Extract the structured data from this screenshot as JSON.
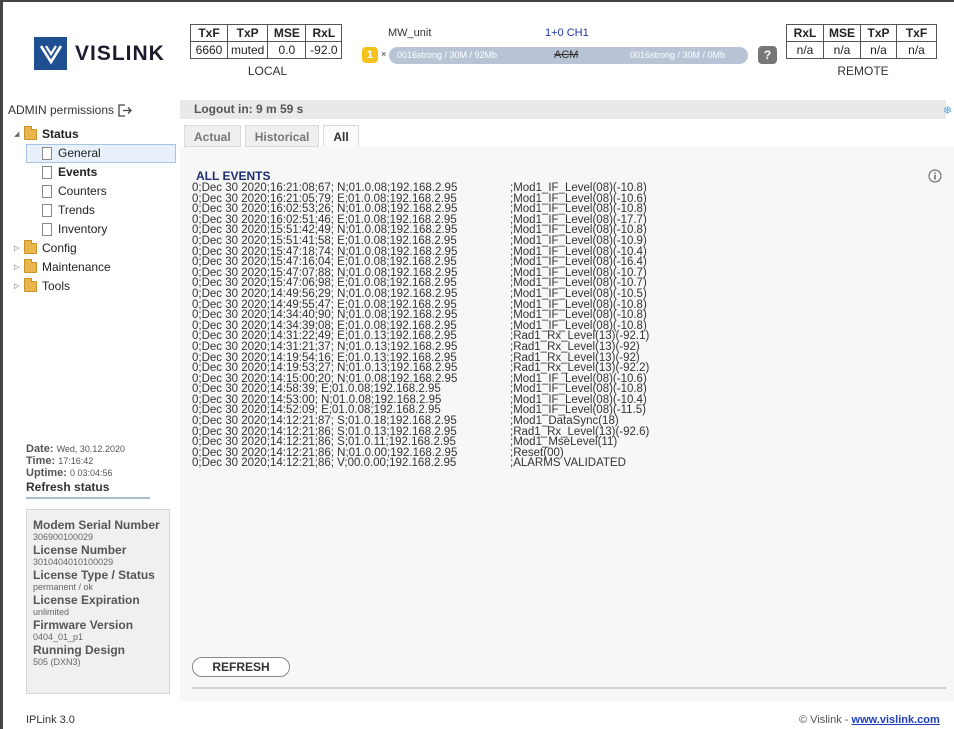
{
  "logo": {
    "text": "VISLINK"
  },
  "local": {
    "headers": [
      "TxF",
      "TxP",
      "MSE",
      "RxL"
    ],
    "values": [
      "6660",
      "muted",
      "0.0",
      "-92.0"
    ],
    "caption": "LOCAL"
  },
  "remote": {
    "headers": [
      "RxL",
      "MSE",
      "TxP",
      "TxF"
    ],
    "values": [
      "n/a",
      "n/a",
      "n/a",
      "n/a"
    ],
    "caption": "REMOTE"
  },
  "link": {
    "unit": "MW_unit",
    "channel": "1+0 CH1",
    "badge": "1",
    "multiplier": "×",
    "left_modulation": "0016strong / 30M / 92Mb",
    "mode": "ACM",
    "right_modulation": "0016strong / 30M / 0Mb",
    "help": "?"
  },
  "sidebar": {
    "admin": "ADMIN permissions",
    "status": "Status",
    "status_items": [
      "General",
      "Events",
      "Counters",
      "Trends",
      "Inventory"
    ],
    "config": "Config",
    "maintenance": "Maintenance",
    "tools": "Tools",
    "date_label": "Date:",
    "date_value": "Wed, 30.12.2020",
    "time_label": "Time:",
    "time_value": "17:16:42",
    "uptime_label": "Uptime:",
    "uptime_value": "0 03:04:56",
    "refresh_status": "Refresh status",
    "modem_serial_label": "Modem Serial Number",
    "modem_serial_value": "306900100029",
    "license_number_label": "License Number",
    "license_number_value": "3010404010100029",
    "license_type_label": "License Type / Status",
    "license_type_value": "permanent / ok",
    "license_exp_label": "License Expiration",
    "license_exp_value": "unlimited",
    "firmware_label": "Firmware Version",
    "firmware_value": "0404_01_p1",
    "design_label": "Running Design",
    "design_value": "505 (DXN3)"
  },
  "main": {
    "logout": "Logout in: 9 m 59 s",
    "tabs": [
      "Actual",
      "Historical",
      "All"
    ],
    "events_title": "ALL EVENTS",
    "refresh_button": "REFRESH",
    "events": [
      {
        "ts": "0;Dec 30 2020;16:21:08;67; N;01.0.08;192.168.2.95",
        "msg": ";Mod1_IF_Level(08)(-10.8)"
      },
      {
        "ts": "0;Dec 30 2020;16:21:05;79; E;01.0.08;192.168.2.95",
        "msg": ";Mod1_IF_Level(08)(-10.6)"
      },
      {
        "ts": "0;Dec 30 2020;16:02:53;26; N;01.0.08;192.168.2.95",
        "msg": ";Mod1_IF_Level(08)(-10.8)"
      },
      {
        "ts": "0;Dec 30 2020;16:02:51;46; E;01.0.08;192.168.2.95",
        "msg": ";Mod1_IF_Level(08)(-17.7)"
      },
      {
        "ts": "0;Dec 30 2020;15:51:42;49; N;01.0.08;192.168.2.95",
        "msg": ";Mod1_IF_Level(08)(-10.8)"
      },
      {
        "ts": "0;Dec 30 2020;15:51:41;58; E;01.0.08;192.168.2.95",
        "msg": ";Mod1_IF_Level(08)(-10.9)"
      },
      {
        "ts": "0;Dec 30 2020;15:47:18;74; N;01.0.08;192.168.2.95",
        "msg": ";Mod1_IF_Level(08)(-10.4)"
      },
      {
        "ts": "0;Dec 30 2020;15:47:16;04; E;01.0.08;192.168.2.95",
        "msg": ";Mod1_IF_Level(08)(-16.4)"
      },
      {
        "ts": "0;Dec 30 2020;15:47:07;88; N;01.0.08;192.168.2.95",
        "msg": ";Mod1_IF_Level(08)(-10.7)"
      },
      {
        "ts": "0;Dec 30 2020;15:47:06;98; E;01.0.08;192.168.2.95",
        "msg": ";Mod1_IF_Level(08)(-10.7)"
      },
      {
        "ts": "0;Dec 30 2020;14:49:56;29; N;01.0.08;192.168.2.95",
        "msg": ";Mod1_IF_Level(08)(-10.5)"
      },
      {
        "ts": "0;Dec 30 2020;14:49:55;47; E;01.0.08;192.168.2.95",
        "msg": ";Mod1_IF_Level(08)(-10.8)"
      },
      {
        "ts": "0;Dec 30 2020;14:34:40;90; N;01.0.08;192.168.2.95",
        "msg": ";Mod1_IF_Level(08)(-10.8)"
      },
      {
        "ts": "0;Dec 30 2020;14:34:39;08; E;01.0.08;192.168.2.95",
        "msg": ";Mod1_IF_Level(08)(-10.8)"
      },
      {
        "ts": "0;Dec 30 2020;14:31:22;49; E;01.0.13;192.168.2.95",
        "msg": ";Rad1_Rx_Level(13)(-92.1)"
      },
      {
        "ts": "0;Dec 30 2020;14:31:21;37; N;01.0.13;192.168.2.95",
        "msg": ";Rad1_Rx_Level(13)(-92)"
      },
      {
        "ts": "0;Dec 30 2020;14:19:54;16; E;01.0.13;192.168.2.95",
        "msg": ";Rad1_Rx_Level(13)(-92)"
      },
      {
        "ts": "0;Dec 30 2020;14:19:53;27; N;01.0.13;192.168.2.95",
        "msg": ";Rad1_Rx_Level(13)(-92.2)"
      },
      {
        "ts": "0;Dec 30 2020;14:15:00;20; N;01.0.08;192.168.2.95",
        "msg": ";Mod1_IF_Level(08)(-10.6)"
      },
      {
        "ts": "0;Dec 30 2020;14:58:39; E;01.0.08;192.168.2.95",
        "msg": ";Mod1_IF_Level(08)(-10.8)"
      },
      {
        "ts": "0;Dec 30 2020;14:53:00; N;01.0.08;192.168.2.95",
        "msg": ";Mod1_IF_Level(08)(-10.4)"
      },
      {
        "ts": "0;Dec 30 2020;14:52:09; E;01.0.08;192.168.2.95",
        "msg": ";Mod1_IF_Level(08)(-11.5)"
      },
      {
        "ts": "0;Dec 30 2020;14:12:21;87; S;01.0.18;192.168.2.95",
        "msg": ";Mod1_DataSync(18)"
      },
      {
        "ts": "0;Dec 30 2020;14:12:21;86; S;01.0.13;192.168.2.95",
        "msg": ";Rad1_Rx_Level(13)(-92.6)"
      },
      {
        "ts": "0;Dec 30 2020;14:12:21;86; S;01.0.11;192.168.2.95",
        "msg": ";Mod1_MseLevel(11)"
      },
      {
        "ts": "0;Dec 30 2020;14:12:21;86; N;01.0.00;192.168.2.95",
        "msg": ";Reset(00)"
      },
      {
        "ts": "0;Dec 30 2020;14:12:21;86; V;00.0.00;192.168.2.95",
        "msg": ";ALARMS VALIDATED"
      }
    ]
  },
  "footer": {
    "left": "IPLink 3.0",
    "copyright": "© Vislink - ",
    "link": "www.vislink.com"
  }
}
